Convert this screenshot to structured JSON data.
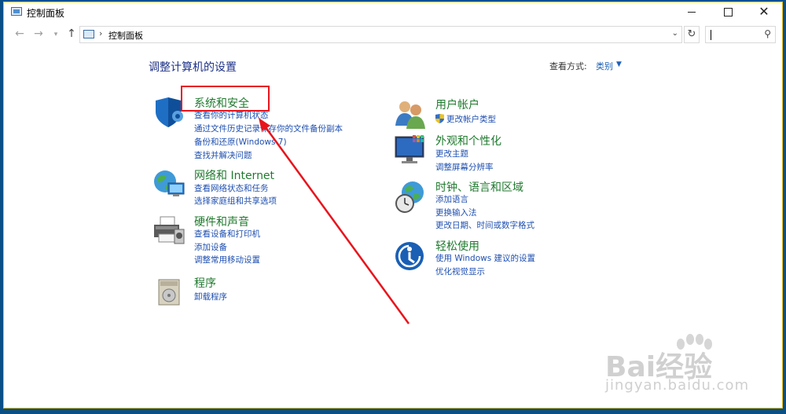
{
  "window": {
    "title": "控制面板",
    "minimize_label": "—",
    "maximize_label": "☐",
    "close_label": "✕"
  },
  "nav": {
    "back_icon": "←",
    "forward_icon": "→",
    "up_icon": "↑",
    "address_separator": "›",
    "address_text": "控制面板",
    "dropdown_icon": "⌄",
    "refresh_icon": "↻",
    "search_placeholder": ""
  },
  "main": {
    "title": "调整计算机的设置",
    "view_by_label": "查看方式:",
    "view_by_value": "类别",
    "view_by_dd": "▼"
  },
  "categories": [
    {
      "id": "system-security",
      "title": "系统和安全",
      "links": [
        "查看你的计算机状态",
        "通过文件历史记录保存你的文件备份副本",
        "备份和还原(Windows 7)",
        "查找并解决问题"
      ]
    },
    {
      "id": "network",
      "title": "网络和 Internet",
      "links": [
        "查看网络状态和任务",
        "选择家庭组和共享选项"
      ]
    },
    {
      "id": "hardware",
      "title": "硬件和声音",
      "links": [
        "查看设备和打印机",
        "添加设备",
        "调整常用移动设置"
      ]
    },
    {
      "id": "programs",
      "title": "程序",
      "links": [
        "卸载程序"
      ]
    },
    {
      "id": "user-accounts",
      "title": "用户帐户",
      "links": [
        "更改帐户类型"
      ]
    },
    {
      "id": "appearance",
      "title": "外观和个性化",
      "links": [
        "更改主题",
        "调整屏幕分辨率"
      ]
    },
    {
      "id": "clock-region",
      "title": "时钟、语言和区域",
      "links": [
        "添加语言",
        "更换输入法",
        "更改日期、时间或数字格式"
      ]
    },
    {
      "id": "ease-access",
      "title": "轻松使用",
      "links": [
        "使用 Windows 建议的设置",
        "优化视觉显示"
      ]
    }
  ],
  "watermark": {
    "brand": "Bai经验",
    "url": "jingyan.baidu.com"
  },
  "colors": {
    "desktop": "#0a4f86",
    "category_title": "#1f7a2e",
    "link": "#1e4fb0",
    "highlight": "#e8141c"
  }
}
